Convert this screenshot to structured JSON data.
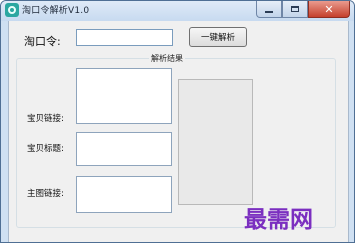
{
  "window": {
    "title": "淘口令解析V1.0",
    "close_glyph": "✕",
    "icon": "app-icon"
  },
  "form": {
    "token_label": "淘口令:",
    "token_value": "",
    "parse_button_label": "一键解析"
  },
  "results": {
    "group_title": "解析结果",
    "product_link_label": "宝贝链接:",
    "product_link_value": "",
    "product_title_label": "宝贝标题:",
    "product_title_value": "",
    "main_image_label": "主图链接:",
    "main_image_value": ""
  },
  "watermark": {
    "text": "最需网"
  },
  "colors": {
    "title_bar": "#c7daf0",
    "close_button": "#c5402d",
    "watermark": "#7b2fc0",
    "panel_background": "#f0f0f0"
  }
}
